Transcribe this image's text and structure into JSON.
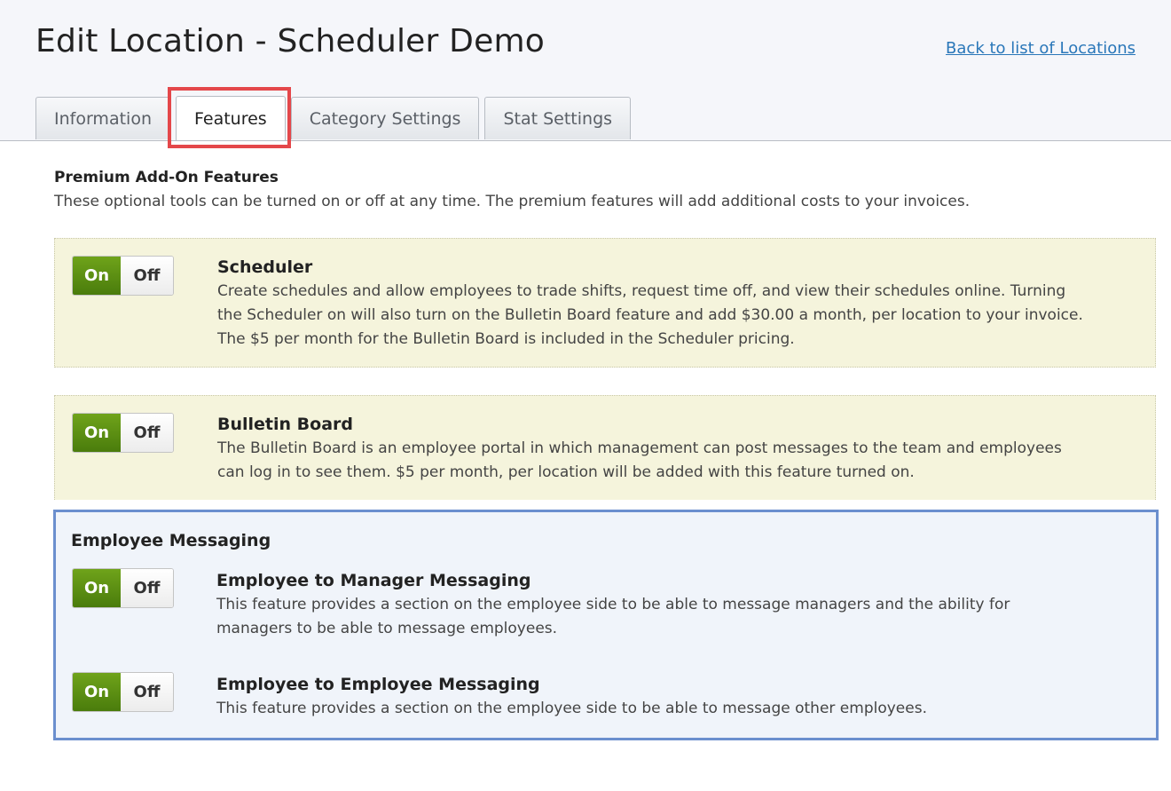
{
  "header": {
    "title": "Edit Location - Scheduler Demo",
    "back_link": "Back to list of Locations"
  },
  "tabs": [
    {
      "label": "Information",
      "active": false
    },
    {
      "label": "Features",
      "active": true
    },
    {
      "label": "Category Settings",
      "active": false
    },
    {
      "label": "Stat Settings",
      "active": false
    }
  ],
  "premium": {
    "title": "Premium Add-On Features",
    "description": "These optional tools can be turned on or off at any time. The premium features will add additional costs to your invoices."
  },
  "features": [
    {
      "title": "Scheduler",
      "description": "Create schedules and allow employees to trade shifts, request time off, and view their schedules online. Turning the Scheduler on will also turn on the Bulletin Board feature and add $30.00 a month, per location to your invoice. The $5 per month for the Bulletin Board is included in the Scheduler pricing.",
      "state": "On"
    },
    {
      "title": "Bulletin Board",
      "description": "The Bulletin Board is an employee portal in which management can post messages to the team and employees can log in to see them. $5 per month, per location will be added with this feature turned on.",
      "state": "On"
    }
  ],
  "messaging": {
    "title": "Employee Messaging",
    "items": [
      {
        "title": "Employee to Manager Messaging",
        "description": "This feature provides a section on the employee side to be able to message managers and the ability for managers to be able to message employees.",
        "state": "On"
      },
      {
        "title": "Employee to Employee Messaging",
        "description": "This feature provides a section on the employee side to be able to message other employees.",
        "state": "On"
      }
    ]
  },
  "toggle": {
    "on_label": "On",
    "off_label": "Off"
  },
  "colors": {
    "toggle_on": "#5a8d12",
    "link": "#2a77b9",
    "feature_bg": "#f5f4dc",
    "messaging_bg": "#f0f4fa",
    "messaging_border": "#6b8fce",
    "tab_highlight": "#e4474a"
  }
}
